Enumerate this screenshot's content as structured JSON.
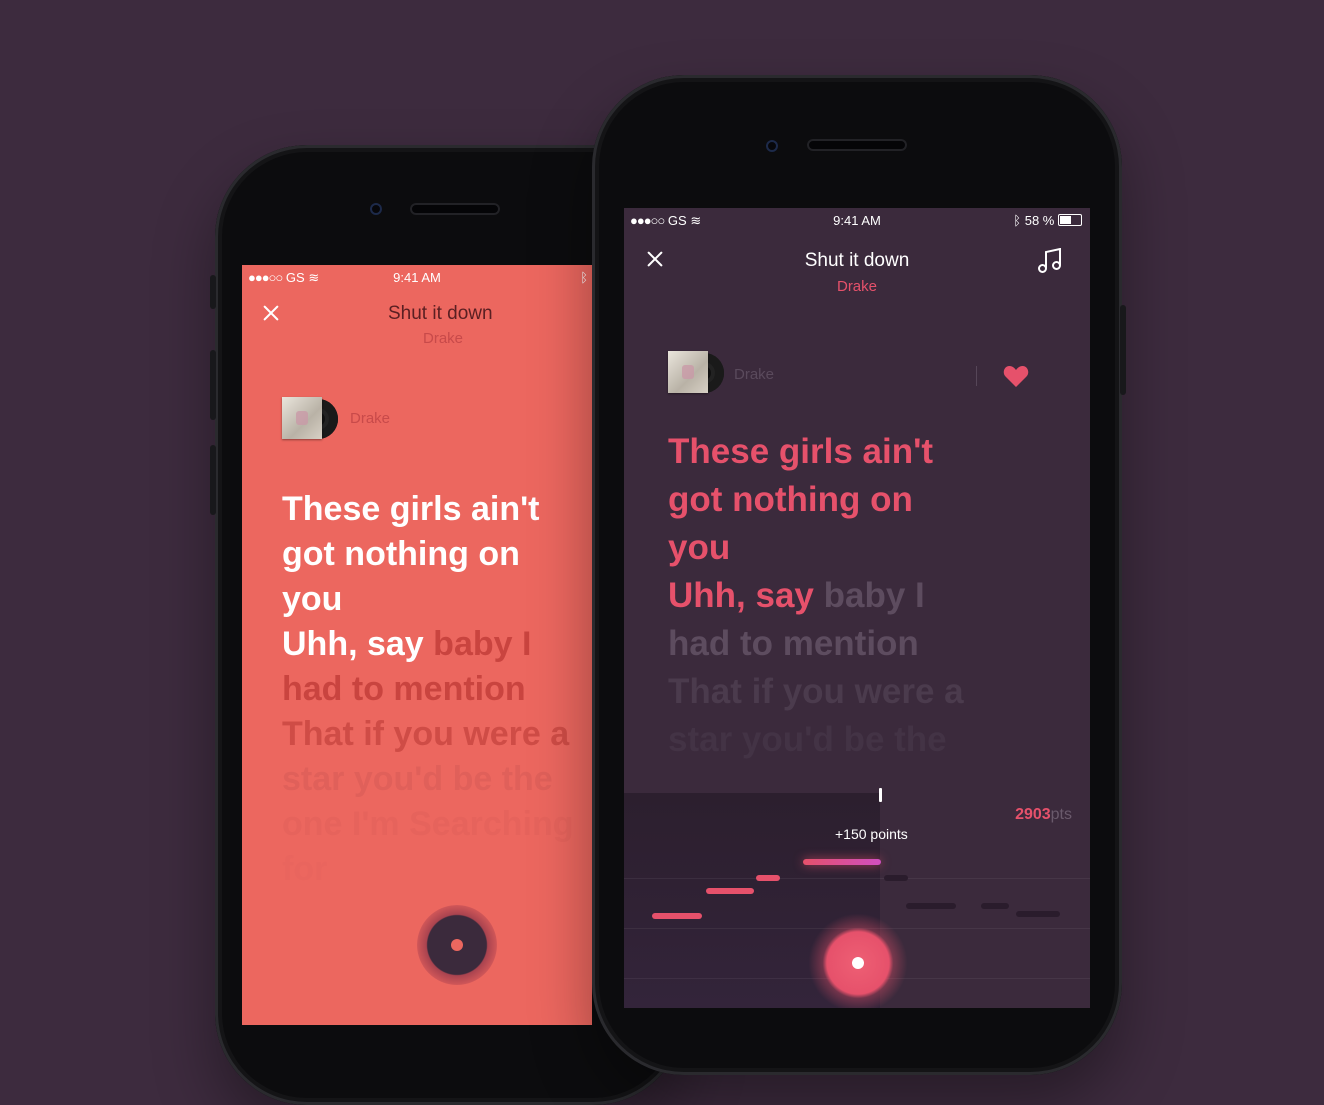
{
  "status": {
    "carrier": "GS",
    "time": "9:41 AM",
    "battery": "58 %"
  },
  "song": {
    "title": "Shut it down",
    "artist": "Drake"
  },
  "left_screen": {
    "lyrics_sung": [
      "These girls ain't",
      "got nothing on",
      "you",
      "Uhh, say"
    ],
    "lyrics_current_rest": "baby I",
    "lyrics_upcoming": [
      "had to mention",
      "That if you were a",
      "star you'd be the",
      "one I'm Searching",
      "for"
    ],
    "accent": "#ec675f"
  },
  "right_screen": {
    "lyrics_sung": [
      "These girls ain't",
      "got nothing on",
      "you",
      "Uhh, say"
    ],
    "lyrics_current_rest": "baby I",
    "lyrics_upcoming": [
      "had to mention",
      "That if you were a",
      "star you'd be the"
    ],
    "bonus": "+150 points",
    "score_value": "2903",
    "score_unit": "pts",
    "accent": "#e6516b"
  },
  "icons": {
    "close": "close-icon",
    "music": "music-note-icon",
    "heart": "heart-icon",
    "wifi": "wifi-icon",
    "bluetooth": "bluetooth-icon",
    "battery": "battery-icon"
  }
}
